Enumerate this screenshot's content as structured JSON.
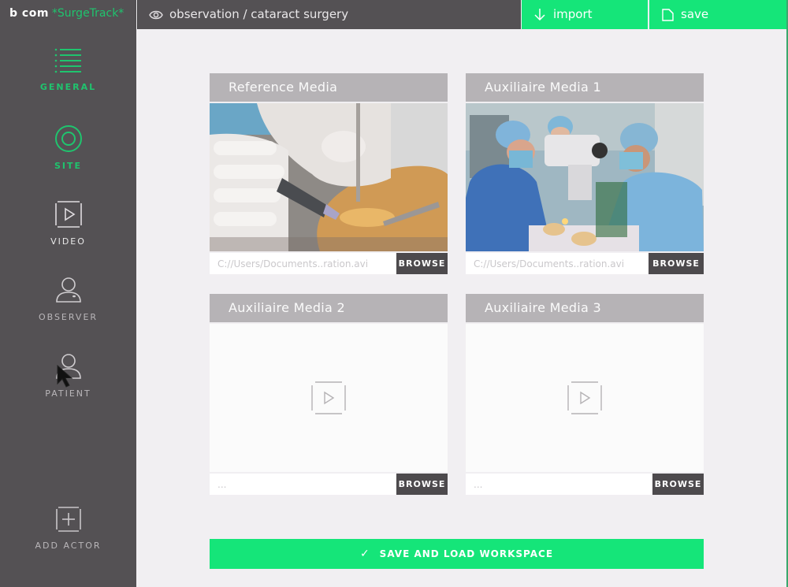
{
  "app": {
    "brand": "b<>com",
    "brand_display": "b com",
    "product": "*SurgeTrack*"
  },
  "colors": {
    "accent": "#15e579",
    "accent_text": "#1fc46e",
    "sidebar_bg": "#545154",
    "card_header_bg": "#b6b3b6",
    "browse_bg": "#4d4a4d",
    "page_bg": "#f1eff2"
  },
  "topbar": {
    "breadcrumb_icon": "eye-icon",
    "breadcrumb": "observation / cataract surgery",
    "import_label": "import",
    "import_icon": "arrow-down-icon",
    "save_label": "save",
    "save_icon": "file-icon"
  },
  "sidebar": {
    "items": [
      {
        "label": "GENERAL",
        "icon": "list-icon",
        "active": true
      },
      {
        "label": "SITE",
        "icon": "target-icon",
        "active": true
      },
      {
        "label": "VIDEO",
        "icon": "play-icon",
        "active": false
      },
      {
        "label": "OBSERVER",
        "icon": "user-icon",
        "active": false
      },
      {
        "label": "PATIENT",
        "icon": "user-icon",
        "active": false
      }
    ],
    "add_actor": {
      "label": "ADD ACTOR",
      "icon": "plus-icon"
    }
  },
  "media": [
    {
      "title": "Reference Media",
      "path": "C://Users/Documents..ration.avi",
      "browse_label": "BROWSE",
      "has_video": true,
      "thumbnail": "cataract surgery close-up"
    },
    {
      "title": "Auxiliaire Media 1",
      "path": "C://Users/Documents..ration.avi",
      "browse_label": "BROWSE",
      "has_video": true,
      "thumbnail": "operating room with surgeons and microscope"
    },
    {
      "title": "Auxiliaire Media 2",
      "path": "...",
      "browse_label": "BROWSE",
      "has_video": false
    },
    {
      "title": "Auxiliaire Media 3",
      "path": "...",
      "browse_label": "BROWSE",
      "has_video": false
    }
  ],
  "footer": {
    "save_load_label": "SAVE AND LOAD WORKSPACE",
    "check_icon": "✓"
  }
}
